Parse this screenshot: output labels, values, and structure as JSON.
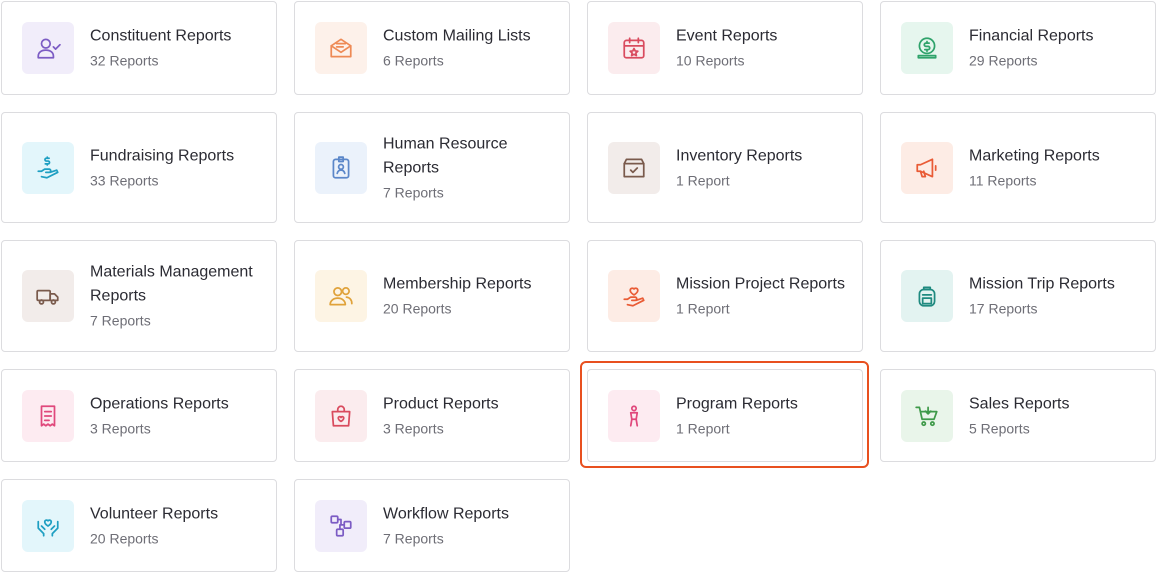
{
  "reports": [
    {
      "title": "Constituent Reports",
      "count": "32 Reports",
      "icon": "user-check-icon",
      "color": "#7c5cc4",
      "bg": "#f1edfa"
    },
    {
      "title": "Custom Mailing Lists",
      "count": "6 Reports",
      "icon": "mail-open-icon",
      "color": "#ee8a55",
      "bg": "#fdf1ea"
    },
    {
      "title": "Event Reports",
      "count": "10 Reports",
      "icon": "calendar-star-icon",
      "color": "#d94b5e",
      "bg": "#fbecee"
    },
    {
      "title": "Financial Reports",
      "count": "29 Reports",
      "icon": "dollar-coin-icon",
      "color": "#2fa36b",
      "bg": "#e6f6ee"
    },
    {
      "title": "Fundraising Reports",
      "count": "33 Reports",
      "icon": "hand-dollar-icon",
      "color": "#1e9fc2",
      "bg": "#e3f6fb"
    },
    {
      "title": "Human Resource Reports",
      "count": "7 Reports",
      "icon": "id-badge-icon",
      "color": "#5b87c9",
      "bg": "#ebf2fb"
    },
    {
      "title": "Inventory Reports",
      "count": "1 Report",
      "icon": "box-check-icon",
      "color": "#7a5a4c",
      "bg": "#f2ecea"
    },
    {
      "title": "Marketing Reports",
      "count": "11 Reports",
      "icon": "megaphone-icon",
      "color": "#e95b35",
      "bg": "#fdece5"
    },
    {
      "title": "Materials Management Reports",
      "count": "7 Reports",
      "icon": "truck-icon",
      "color": "#7a5a4c",
      "bg": "#f2ecea"
    },
    {
      "title": "Membership Reports",
      "count": "20 Reports",
      "icon": "users-icon",
      "color": "#e0a23a",
      "bg": "#fdf4e4"
    },
    {
      "title": "Mission Project Reports",
      "count": "1 Report",
      "icon": "hand-heart-icon",
      "color": "#e95b35",
      "bg": "#fdece5"
    },
    {
      "title": "Mission Trip Reports",
      "count": "17 Reports",
      "icon": "backpack-icon",
      "color": "#1f8a80",
      "bg": "#e3f3f1"
    },
    {
      "title": "Operations Reports",
      "count": "3 Reports",
      "icon": "receipt-icon",
      "color": "#e0487c",
      "bg": "#fdebf1"
    },
    {
      "title": "Product Reports",
      "count": "3 Reports",
      "icon": "shopping-bag-heart-icon",
      "color": "#d94b5e",
      "bg": "#fbecee"
    },
    {
      "title": "Program Reports",
      "count": "1 Report",
      "icon": "child-icon",
      "color": "#e0487c",
      "bg": "#fdebf1"
    },
    {
      "title": "Sales Reports",
      "count": "5 Reports",
      "icon": "cart-icon",
      "color": "#3f9a4a",
      "bg": "#e9f5ea"
    },
    {
      "title": "Volunteer Reports",
      "count": "20 Reports",
      "icon": "hands-heart-icon",
      "color": "#1e9fc2",
      "bg": "#e3f6fb"
    },
    {
      "title": "Workflow Reports",
      "count": "7 Reports",
      "icon": "workflow-icon",
      "color": "#7c5cc4",
      "bg": "#f1edfa"
    }
  ]
}
